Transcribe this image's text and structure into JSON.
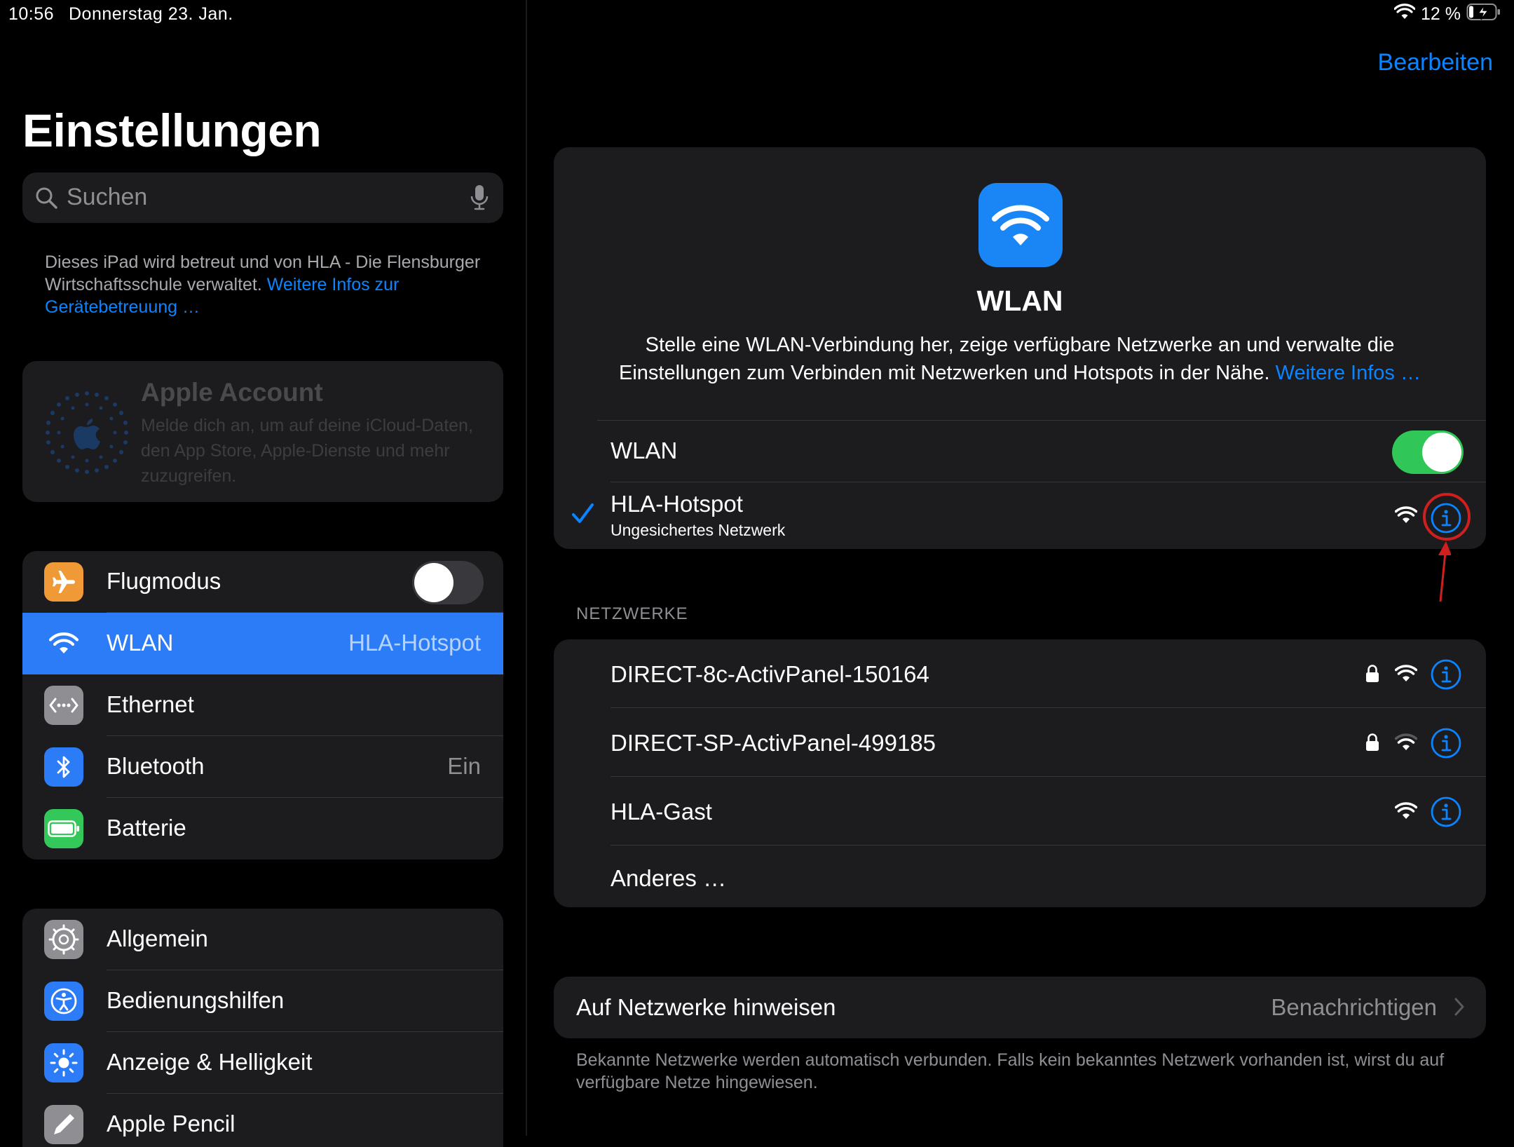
{
  "status_bar": {
    "time": "10:56",
    "date": "Donnerstag 23. Jan.",
    "battery_percent": "12 %",
    "wifi_icon": "wifi-icon",
    "battery_icon": "battery-charging-icon"
  },
  "sidebar": {
    "title": "Einstellungen",
    "search_placeholder": "Suchen",
    "managed_note": "Dieses iPad wird betreut und von HLA - Die Flensburger Wirtschaftsschule verwaltet.",
    "managed_link": "Weitere Infos zur Gerätebetreuung …",
    "account": {
      "title": "Apple Account",
      "subtitle": "Melde dich an, um auf deine iCloud-Daten, den App Store, Apple-Dienste und mehr zuzugreifen."
    },
    "group1": [
      {
        "label": "Flugmodus",
        "value": "",
        "icon": "airplane-icon",
        "color": "#f09a37"
      },
      {
        "label": "WLAN",
        "value": "HLA-Hotspot",
        "icon": "wifi-icon",
        "color": "#2b7cf6",
        "selected": true
      },
      {
        "label": "Ethernet",
        "value": "",
        "icon": "ethernet-icon",
        "color": "#8e8e93"
      },
      {
        "label": "Bluetooth",
        "value": "Ein",
        "icon": "bluetooth-icon",
        "color": "#2b7cf6"
      },
      {
        "label": "Batterie",
        "value": "",
        "icon": "battery-icon",
        "color": "#34c759"
      }
    ],
    "airplane_mode_on": false,
    "group2": [
      {
        "label": "Allgemein",
        "icon": "gear-icon",
        "color": "#8e8e93"
      },
      {
        "label": "Bedienungshilfen",
        "icon": "accessibility-icon",
        "color": "#2b7cf6"
      },
      {
        "label": "Anzeige & Helligkeit",
        "icon": "brightness-icon",
        "color": "#2b7cf6"
      },
      {
        "label": "Apple Pencil",
        "icon": "pencil-icon",
        "color": "#8e8e93"
      }
    ]
  },
  "main": {
    "edit_label": "Bearbeiten",
    "title": "WLAN",
    "description": "Stelle eine WLAN-Verbindung her, zeige verfügbare Netzwerke an und verwalte die Einstellungen zum Verbinden mit Netzwerken und Hotspots in der Nähe.",
    "description_link": "Weitere Infos …",
    "wlan_label": "WLAN",
    "wlan_on": true,
    "connected": {
      "name": "HLA-Hotspot",
      "subtitle": "Ungesichertes Netzwerk"
    },
    "networks_header": "NETZWERKE",
    "networks": [
      {
        "name": "DIRECT-8c-ActivPanel-150164",
        "locked": true,
        "signal": 3
      },
      {
        "name": "DIRECT-SP-ActivPanel-499185",
        "locked": true,
        "signal": 2
      },
      {
        "name": "HLA-Gast",
        "locked": false,
        "signal": 3
      }
    ],
    "other_label": "Anderes …",
    "notify": {
      "label": "Auf Netzwerke hinweisen",
      "value": "Benachrichtigen",
      "footer": "Bekannte Netzwerke werden automatisch verbunden. Falls kein bekanntes Netzwerk vorhanden ist, wirst du auf verfügbare Netze hingewiesen."
    },
    "accent_color": "#0a84ff",
    "annotation_color": "#d01f1f"
  }
}
